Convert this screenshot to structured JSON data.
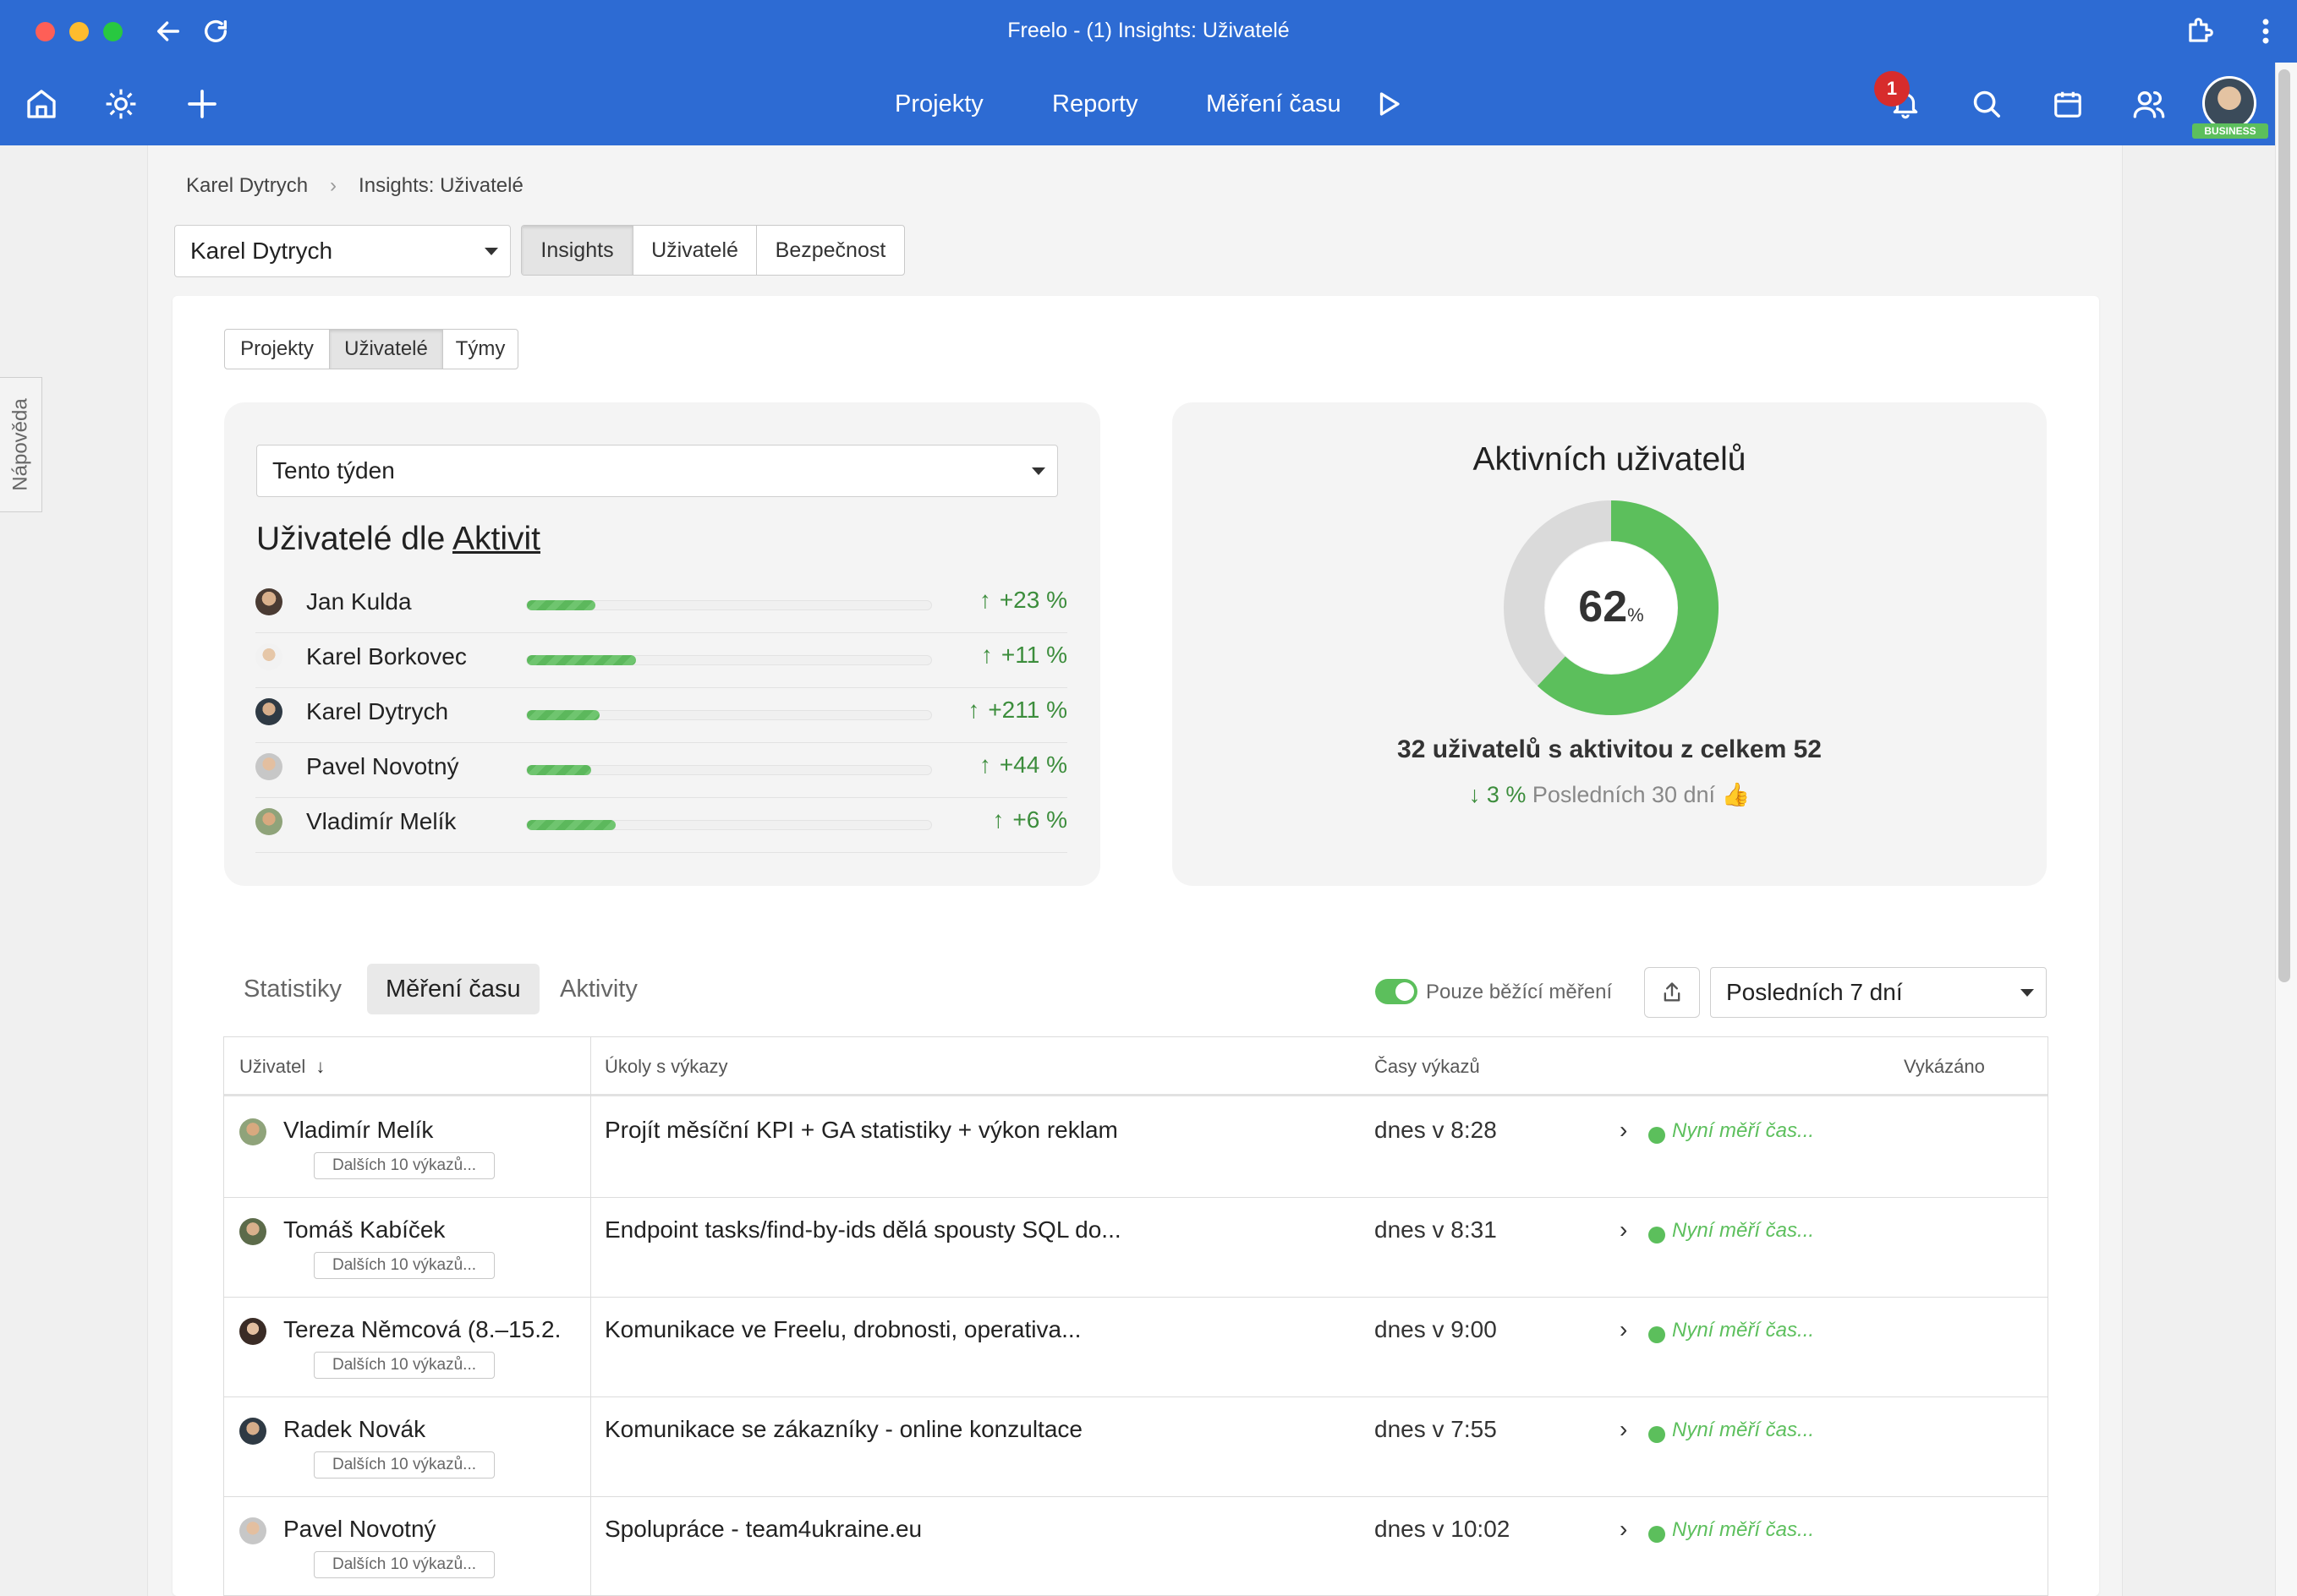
{
  "window": {
    "title": "Freelo - (1) Insights: Uživatelé"
  },
  "nav": {
    "links": [
      "Projekty",
      "Reporty",
      "Měření času"
    ],
    "notification_count": "1",
    "plan_badge": "BUSINESS"
  },
  "help_tab": "Nápověda",
  "breadcrumb": [
    "Karel Dytrych",
    "Insights: Uživatelé"
  ],
  "account_select": {
    "value": "Karel Dytrych"
  },
  "section_tabs": [
    "Insights",
    "Uživatelé",
    "Bezpečnost"
  ],
  "section_tabs_active": 0,
  "sub_tabs": [
    "Projekty",
    "Uživatelé",
    "Týmy"
  ],
  "sub_tabs_active": 1,
  "period_select": {
    "value": "Tento týden"
  },
  "activity_panel": {
    "title_prefix": "Uživatelé dle ",
    "title_link": "Aktivit",
    "users": [
      {
        "name": "Jan Kulda",
        "activity": 0.17,
        "change": "+23 %",
        "arrow": "↑"
      },
      {
        "name": "Karel Borkovec",
        "activity": 0.27,
        "change": "+11 %",
        "arrow": "↑"
      },
      {
        "name": "Karel Dytrych",
        "activity": 0.18,
        "change": "+211 %",
        "arrow": "↑"
      },
      {
        "name": "Pavel Novotný",
        "activity": 0.16,
        "change": "+44 %",
        "arrow": "↑"
      },
      {
        "name": "Vladimír Melík",
        "activity": 0.22,
        "change": "+6 %",
        "arrow": "↑"
      }
    ]
  },
  "active_panel": {
    "title": "Aktivních uživatelů",
    "percent": 62,
    "percent_value": "62",
    "percent_unit": "%",
    "summary": "32 uživatelů s aktivitou z celkem 52",
    "trend_arrow": "↓",
    "trend_value": "3 %",
    "trend_label": "Posledních 30 dní",
    "trend_emoji": "👍",
    "colors": {
      "active": "#5cbf5c",
      "inactive": "#dadada"
    }
  },
  "bottom_tabs": [
    "Statistiky",
    "Měření času",
    "Aktivity"
  ],
  "bottom_tabs_active": 1,
  "running_toggle": {
    "label": "Pouze běžící měření",
    "on": true
  },
  "range_select": {
    "value": "Posledních 7 dní"
  },
  "table": {
    "headers": {
      "user": "Uživatel",
      "sort_arrow": "↓",
      "tasks": "Úkoly s výkazy",
      "times": "Časy výkazů",
      "reported": "Vykázáno"
    },
    "rows": [
      {
        "user": "Vladimír Melík",
        "more": "Dalších 10 výkazů...",
        "task": "Projít měsíční KPI + GA statistiky + výkon reklam",
        "time": "dnes v 8:28",
        "status": "Nyní měří čas..."
      },
      {
        "user": "Tomáš Kabíček",
        "more": "Dalších 10 výkazů...",
        "task": "Endpoint tasks/find-by-ids dělá spousty SQL do...",
        "time": "dnes v 8:31",
        "status": "Nyní měří čas..."
      },
      {
        "user": "Tereza Němcová (8.–15.2.",
        "more": "Dalších 10 výkazů...",
        "task": "Komunikace ve Freelu, drobnosti, operativa...",
        "time": "dnes v 9:00",
        "status": "Nyní měří čas..."
      },
      {
        "user": "Radek Novák",
        "more": "Dalších 10 výkazů...",
        "task": "Komunikace se zákazníky - online konzultace",
        "time": "dnes v 7:55",
        "status": "Nyní měří čas..."
      },
      {
        "user": "Pavel Novotný",
        "more": "Dalších 10 výkazů...",
        "task": "Spolupráce - team4ukraine.eu",
        "time": "dnes v 10:02",
        "status": "Nyní měří čas..."
      }
    ]
  }
}
